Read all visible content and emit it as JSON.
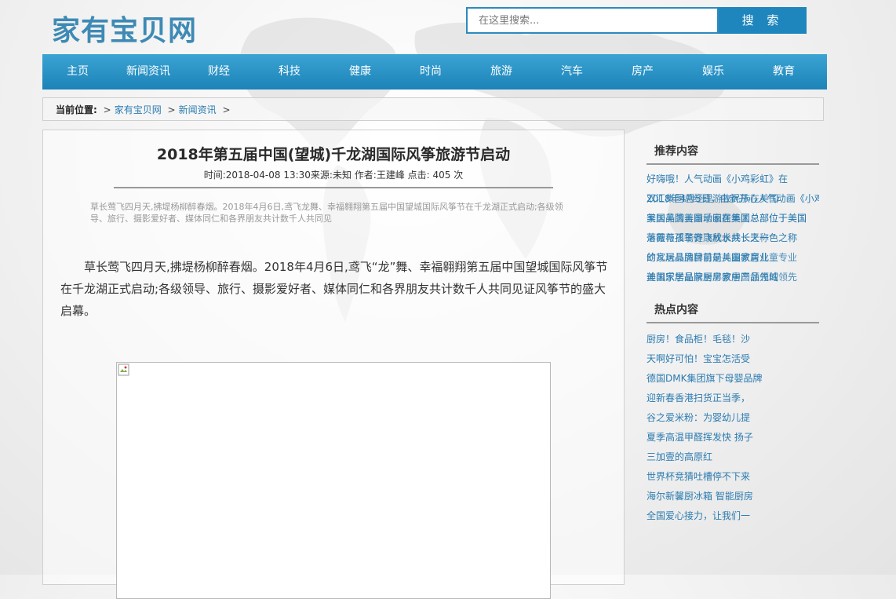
{
  "site": {
    "logo": "家有宝贝网"
  },
  "search": {
    "placeholder": "在这里搜索...",
    "button_label": "搜 索"
  },
  "nav": [
    "主页",
    "新闻资讯",
    "财经",
    "科技",
    "健康",
    "时尚",
    "旅游",
    "汽车",
    "房产",
    "娱乐",
    "教育"
  ],
  "breadcrumb": {
    "prefix": "当前位置:",
    "items": [
      "家有宝贝网",
      "新闻资讯"
    ],
    "sep": ">"
  },
  "article": {
    "title": "2018年第五届中国(望城)千龙湖国际风筝旅游节启动",
    "meta": "时间:2018-04-08 13:30来源:未知 作者:王建峰 点击: 405 次",
    "summary": "草长莺飞四月天,拂堤杨柳醉春烟。2018年4月6日,鸢飞龙舞、幸福翱翔第五届中国望城国际风筝节在千龙湖正式启动;各级领导、旅行、摄影爱好者、媒体同仁和各界朋友共计数千人共同见",
    "body": "草长莺飞四月天,拂堤杨柳醉春烟。2018年4月6日,鸢飞“龙”舞、幸福翱翔第五届中国望城国际风筝节在千龙湖正式启动;各级领导、旅行、摄影爱好者、媒体同仁和各界朋友共计数千人共同见证风筝节的盛大启幕。"
  },
  "recommended": {
    "heading": "推荐内容",
    "first": "好嗨哦！人气动画《小鸡彩虹》在",
    "overlapped": [
      [
        "2018年4月5日，由新开心人气动画《小鸡",
        "双汇集团总经理游牧民族在美国"
      ],
      [
        "美国美国美国动画在美国总部位于美国",
        "家居品牌吉意乐家居集团总部位于美国"
      ],
      [
        "落霞与孤鹜齐飞秋水共长天一色之称",
        "萧薇薇孩子健康成长成长之称"
      ],
      [
        "的家居品牌目前是美国家居业",
        "幼儿玩具品牌目前儿童教育儿童专业"
      ],
      [
        "美国家居品牌厨房家居产品领域",
        "迪凯乐学是家居早教中国领先的领先"
      ]
    ]
  },
  "hot": {
    "heading": "热点内容",
    "items": [
      "厨房！食品柜！毛毯！沙",
      "天啊好可怕！宝宝怎活受",
      "德国DMK集团旗下母婴品牌",
      "迎新春香港扫货正当季，",
      "谷之爱米粉：为婴幼儿提",
      "夏季高温甲醛挥发快 扬子",
      "三加壹的高原红",
      "世界杯竞猜吐槽停不下来",
      "海尔新馨厨冰箱 智能厨房",
      "全国爱心接力，让我们一"
    ]
  }
}
